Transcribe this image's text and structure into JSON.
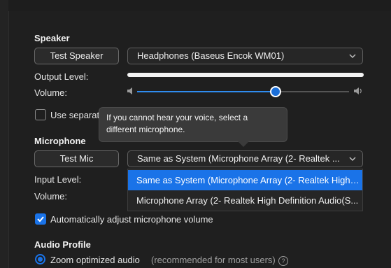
{
  "speaker": {
    "title": "Speaker",
    "test_button": "Test Speaker",
    "device": "Headphones (Baseus Encok WM01)",
    "output_level_label": "Output Level:",
    "output_level": 1.0,
    "volume_label": "Volume:",
    "volume": 0.7
  },
  "use_separate": {
    "label": "Use separat",
    "checked": false
  },
  "tooltip": {
    "text": "If you cannot hear your voice, select a different microphone."
  },
  "microphone": {
    "title": "Microphone",
    "test_button": "Test Mic",
    "device": "Same as System (Microphone Array (2- Realtek ...",
    "input_level_label": "Input Level:",
    "volume_label": "Volume:",
    "options": [
      "Same as System (Microphone Array (2- Realtek High ...",
      "Microphone Array (2- Realtek High Definition Audio(S..."
    ],
    "selected_index": 0
  },
  "auto_adjust": {
    "label": "Automatically adjust microphone volume",
    "checked": true
  },
  "audio_profile": {
    "title": "Audio Profile",
    "option_label": "Zoom optimized audio",
    "option_note": "(recommended for most users)",
    "help": "?"
  },
  "colors": {
    "accent": "#1a73e8",
    "background": "#1f1f1f"
  }
}
